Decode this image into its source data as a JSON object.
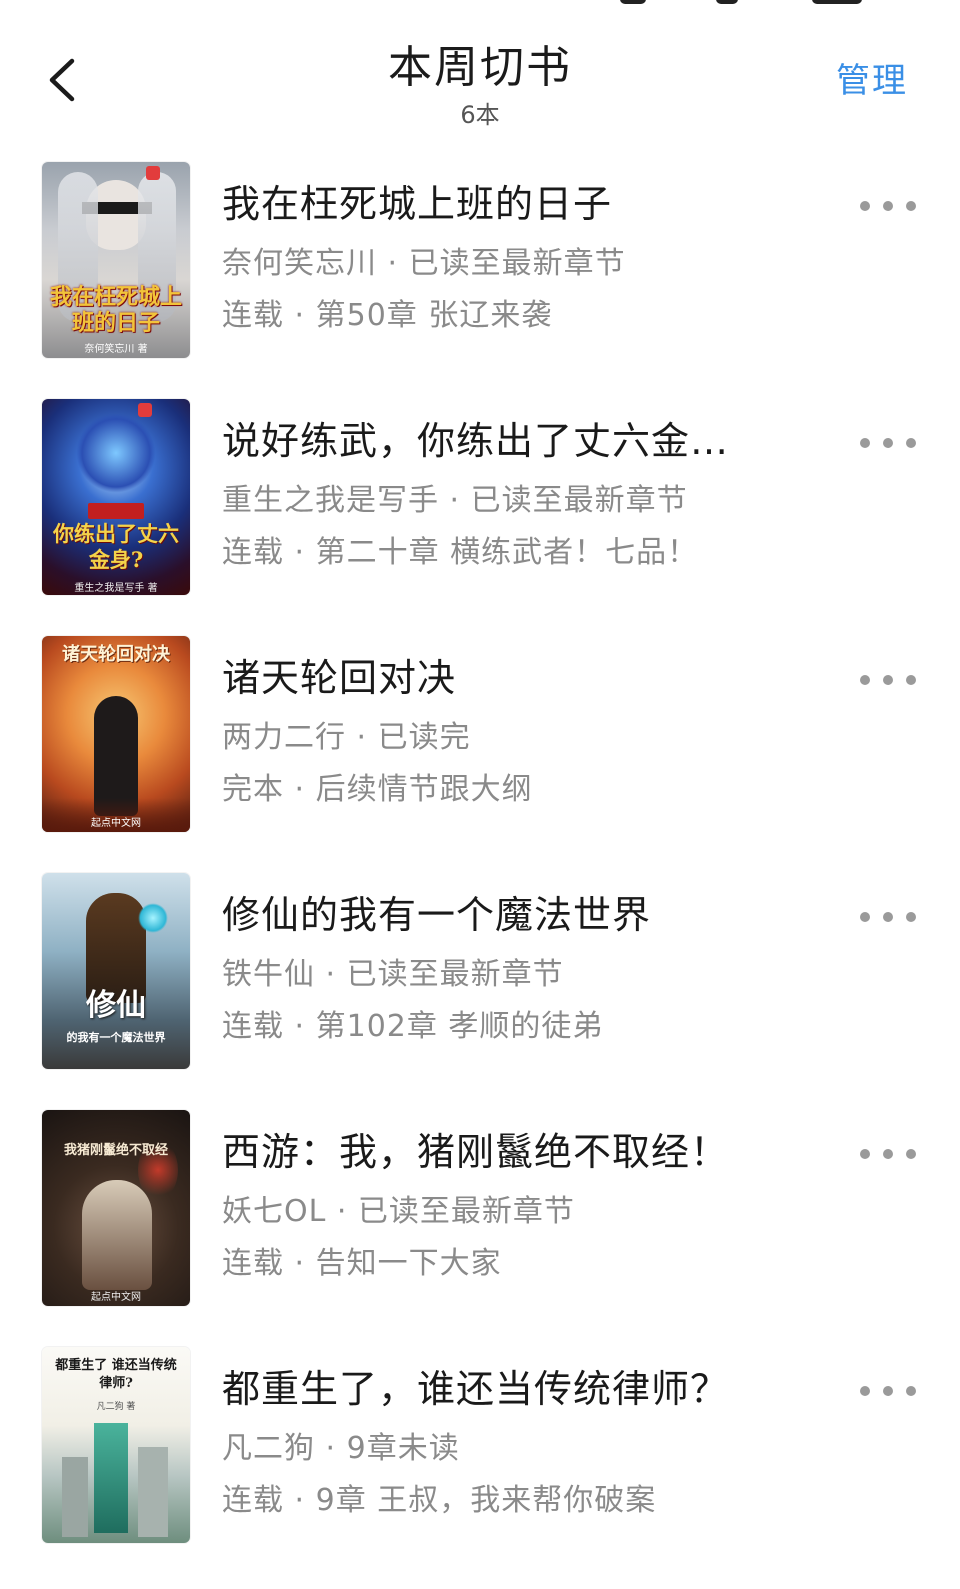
{
  "header": {
    "title": "本周切书",
    "count": "6本",
    "manage_label": "管理"
  },
  "icons": {
    "back": "chevron-left-icon",
    "more": "more-horizontal-icon"
  },
  "colors": {
    "accent": "#3a8fe6",
    "secondary_text": "#8a8a8a"
  },
  "books": [
    {
      "title": "我在枉死城上班的日子",
      "meta": "奈何笑忘川 · 已读至最新章节",
      "status": "连载 · 第50章 张辽来袭",
      "cover_text": "我在枉死城上班的日子",
      "cover_author": "奈何笑忘川 著"
    },
    {
      "title": "说好练武，你练出了丈六金…",
      "meta": "重生之我是写手 · 已读至最新章节",
      "status": "连载 · 第二十章 横练武者！七品！",
      "cover_text": "你练出了丈六金身?",
      "cover_author": "重生之我是写手 著"
    },
    {
      "title": "诸天轮回对决",
      "meta": "两力二行 · 已读完",
      "status": "完本 · 后续情节跟大纲",
      "cover_text": "诸天轮回对决",
      "cover_author": "起点中文网"
    },
    {
      "title": "修仙的我有一个魔法世界",
      "meta": "铁牛仙 · 已读至最新章节",
      "status": "连载 · 第102章 孝顺的徒弟",
      "cover_text": "修仙",
      "cover_author": "的我有一个魔法世界"
    },
    {
      "title": "西游：我，猪刚鬣绝不取经！",
      "meta": "妖七OL · 已读至最新章节",
      "status": "连载 · 告知一下大家",
      "cover_text": "我猪刚鬣绝不取经",
      "cover_author": "起点中文网"
    },
    {
      "title": "都重生了，谁还当传统律师？",
      "meta": "凡二狗 · 9章未读",
      "status": "连载 · 9章 王叔，我来帮你破案",
      "cover_text": "都重生了 谁还当传统律师?",
      "cover_author": "凡二狗 著"
    }
  ]
}
